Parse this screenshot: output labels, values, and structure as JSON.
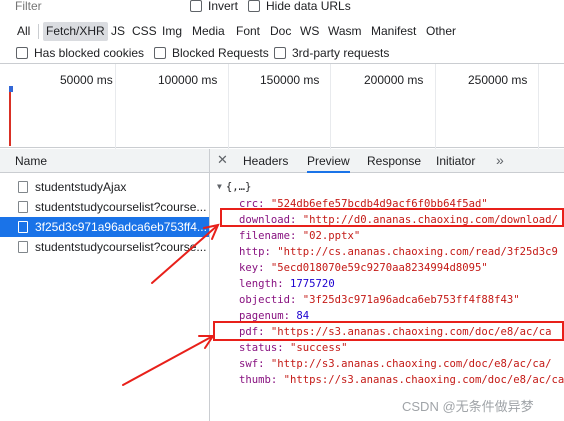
{
  "filter": {
    "placeholder": "Filter",
    "invert_label": "Invert",
    "hide_data_urls_label": "Hide data URLs"
  },
  "type_filters": [
    "All",
    "Fetch/XHR",
    "JS",
    "CSS",
    "Img",
    "Media",
    "Font",
    "Doc",
    "WS",
    "Wasm",
    "Manifest",
    "Other"
  ],
  "active_type_filter": "Fetch/XHR",
  "options": {
    "has_blocked_cookies": "Has blocked cookies",
    "blocked_requests": "Blocked Requests",
    "third_party_requests": "3rd-party requests"
  },
  "overview": {
    "ticks": [
      "50000 ms",
      "100000 ms",
      "150000 ms",
      "200000 ms",
      "250000 ms"
    ]
  },
  "requests": {
    "header": "Name",
    "items": [
      "studentstudyAjax",
      "studentstudycourselist?course...",
      "3f25d3c971a96adca6eb753ff4...",
      "studentstudycourselist?course..."
    ],
    "selected_index": 2
  },
  "detail": {
    "tabs": [
      "Headers",
      "Preview",
      "Response",
      "Initiator"
    ],
    "active_tab": "Preview",
    "root_label": "{,…}",
    "fields": [
      {
        "key": "crc",
        "value": "\"524db6efe57bcdb4d9acf6f0bb64f5ad\"",
        "type": "string"
      },
      {
        "key": "download",
        "value": "\"http://d0.ananas.chaoxing.com/download/",
        "type": "string"
      },
      {
        "key": "filename",
        "value": "\"02.pptx\"",
        "type": "string"
      },
      {
        "key": "http",
        "value": "\"http://cs.ananas.chaoxing.com/read/3f25d3c9",
        "type": "string"
      },
      {
        "key": "key",
        "value": "\"5ecd018070e59c9270aa8234994d8095\"",
        "type": "string"
      },
      {
        "key": "length",
        "value": "1775720",
        "type": "number"
      },
      {
        "key": "objectid",
        "value": "\"3f25d3c971a96adca6eb753ff4f88f43\"",
        "type": "string"
      },
      {
        "key": "pagenum",
        "value": "84",
        "type": "number"
      },
      {
        "key": "pdf",
        "value": "\"https://s3.ananas.chaoxing.com/doc/e8/ac/ca",
        "type": "string"
      },
      {
        "key": "status",
        "value": "\"success\"",
        "type": "string"
      },
      {
        "key": "swf",
        "value": "\"http://s3.ananas.chaoxing.com/doc/e8/ac/ca/",
        "type": "string"
      },
      {
        "key": "thumb",
        "value": "\"https://s3.ananas.chaoxing.com/doc/e8/ac/ca",
        "type": "string"
      }
    ]
  },
  "watermark": "CSDN @无条件做异梦",
  "colors": {
    "selection": "#1a73e8",
    "annotation": "#e8201a",
    "json_key": "#881280",
    "json_string": "#c41a16",
    "json_number": "#1c00cf"
  }
}
